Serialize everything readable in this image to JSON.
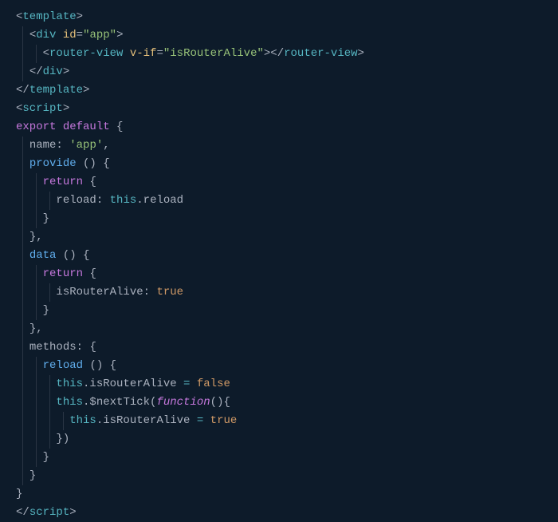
{
  "lines": {
    "l1_open": "<",
    "l1_tag": "template",
    "l1_close": ">",
    "l2_indent": "  ",
    "l2_open": "<",
    "l2_tag": "div",
    "l2_sp": " ",
    "l2_attr": "id",
    "l2_eq": "=",
    "l2_val": "\"app\"",
    "l2_close": ">",
    "l3_indent": "    ",
    "l3_open": "<",
    "l3_tag": "router-view",
    "l3_sp": " ",
    "l3_attr": "v-if",
    "l3_eq": "=",
    "l3_val": "\"isRouterAlive\"",
    "l3_close1": ">",
    "l3_open2": "</",
    "l3_tag2": "router-view",
    "l3_close2": ">",
    "l4_indent": "  ",
    "l4_open": "</",
    "l4_tag": "div",
    "l4_close": ">",
    "l5_open": "</",
    "l5_tag": "template",
    "l5_close": ">",
    "l6_open": "<",
    "l6_tag": "script",
    "l6_close": ">",
    "l7_export": "export",
    "l7_sp1": " ",
    "l7_default": "default",
    "l7_sp2": " ",
    "l7_brace": "{",
    "l8_indent": "  ",
    "l8_name": "name",
    "l8_colon": ": ",
    "l8_val": "'app'",
    "l8_comma": ",",
    "l9_indent": "  ",
    "l9_provide": "provide",
    "l9_sp": " ",
    "l9_paren": "()",
    "l9_sp2": " ",
    "l9_brace": "{",
    "l10_indent": "    ",
    "l10_return": "return",
    "l10_sp": " ",
    "l10_brace": "{",
    "l11_indent": "      ",
    "l11_reload": "reload",
    "l11_colon": ": ",
    "l11_this": "this",
    "l11_dot": ".reload",
    "l12_indent": "    ",
    "l12_brace": "}",
    "l13_indent": "  ",
    "l13_close": "},",
    "l14_indent": "  ",
    "l14_data": "data",
    "l14_sp": " ",
    "l14_paren": "()",
    "l14_sp2": " ",
    "l14_brace": "{",
    "l15_indent": "    ",
    "l15_return": "return",
    "l15_sp": " ",
    "l15_brace": "{",
    "l16_indent": "      ",
    "l16_prop": "isRouterAlive",
    "l16_colon": ": ",
    "l16_val": "true",
    "l17_indent": "    ",
    "l17_brace": "}",
    "l18_indent": "  ",
    "l18_close": "},",
    "l19_indent": "  ",
    "l19_methods": "methods",
    "l19_colon": ": ",
    "l19_brace": "{",
    "l20_indent": "    ",
    "l20_reload": "reload",
    "l20_sp": " ",
    "l20_paren": "()",
    "l20_sp2": " ",
    "l20_brace": "{",
    "l21_indent": "      ",
    "l21_this": "this",
    "l21_dot": ".isRouterAlive",
    "l21_eq": " = ",
    "l21_val": "false",
    "l22_indent": "      ",
    "l22_this": "this",
    "l22_dot": ".$nextTick(",
    "l22_func": "function",
    "l22_paren": "(){",
    "l23_indent": "        ",
    "l23_this": "this",
    "l23_dot": ".isRouterAlive",
    "l23_eq": " = ",
    "l23_val": "true",
    "l24_indent": "      ",
    "l24_close": "})",
    "l25_indent": "    ",
    "l25_brace": "}",
    "l26_indent": "  ",
    "l26_brace": "}",
    "l27_brace": "}",
    "l28_open": "</",
    "l28_tag": "script",
    "l28_close": ">"
  }
}
